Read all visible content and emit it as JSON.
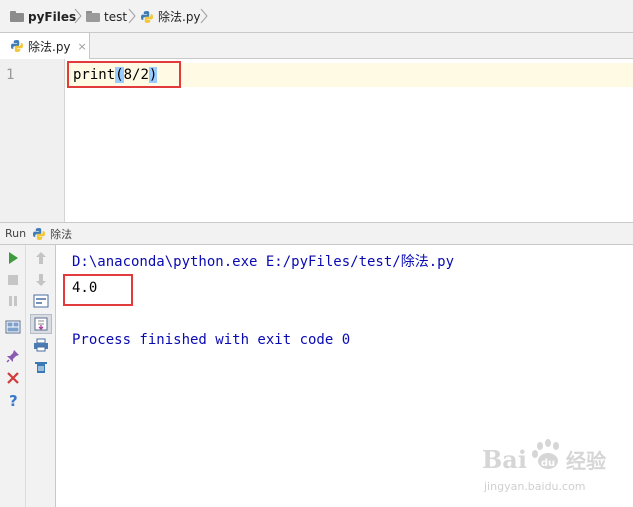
{
  "breadcrumb": {
    "project": "pyFiles",
    "folder": "test",
    "file": "除法.py"
  },
  "editor_tab": {
    "label": "除法.py",
    "close_glyph": "×"
  },
  "editor": {
    "line_number": "1",
    "code": {
      "func": "print",
      "open": "(",
      "expr": "8/2",
      "close": ")"
    }
  },
  "run_panel": {
    "title": "Run",
    "config_name": "除法",
    "left_toolbar": [
      "run-icon",
      "stop-icon",
      "pause-icon",
      "layout-icon",
      "pin-icon",
      "close-icon",
      "help-icon"
    ],
    "right_toolbar": [
      "up-arrow-icon",
      "down-arrow-icon",
      "soft-wrap-icon",
      "scroll-to-end-icon",
      "print-icon",
      "trash-icon"
    ]
  },
  "console": {
    "command": "D:\\anaconda\\python.exe E:/pyFiles/test/除法.py",
    "output": "4.0",
    "exit_message": "Process finished with exit code 0"
  },
  "watermark": {
    "logo_text": "Bai 经验",
    "url": "jingyan.baidu.com"
  },
  "colors": {
    "console_blue": "#0a0ab4",
    "highlight_box": "#e23b3b",
    "caret_line": "#fffae3",
    "bracket_match": "#99ccff",
    "run_green": "#3c9b3c"
  }
}
